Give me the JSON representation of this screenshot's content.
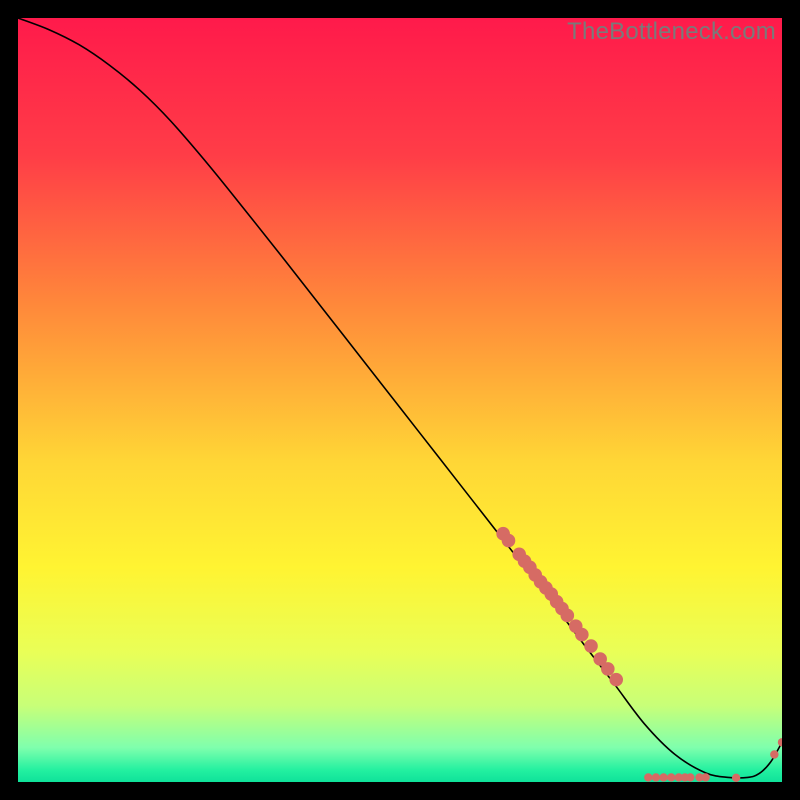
{
  "watermark": {
    "text": "TheBottleneck.com"
  },
  "chart_data": {
    "type": "line",
    "title": "",
    "xlabel": "",
    "ylabel": "",
    "xlim": [
      0,
      100
    ],
    "ylim": [
      0,
      100
    ],
    "grid": false,
    "legend": false,
    "background_gradient": {
      "stops": [
        {
          "pos": 0.0,
          "color": "#ff1a4b"
        },
        {
          "pos": 0.18,
          "color": "#ff3d47"
        },
        {
          "pos": 0.38,
          "color": "#ff8a3a"
        },
        {
          "pos": 0.58,
          "color": "#ffd636"
        },
        {
          "pos": 0.72,
          "color": "#fff432"
        },
        {
          "pos": 0.83,
          "color": "#e9ff57"
        },
        {
          "pos": 0.9,
          "color": "#c8ff78"
        },
        {
          "pos": 0.955,
          "color": "#7fffad"
        },
        {
          "pos": 0.985,
          "color": "#22f0a0"
        },
        {
          "pos": 1.0,
          "color": "#0fe29a"
        }
      ]
    },
    "series": [
      {
        "name": "bottleneck-curve",
        "color": "#000000",
        "width": 1.6,
        "x": [
          0,
          4,
          8,
          12,
          16,
          20,
          25,
          30,
          35,
          40,
          45,
          50,
          55,
          60,
          65,
          70,
          74,
          78,
          82,
          86,
          90,
          93,
          95.5,
          97,
          98.5,
          100
        ],
        "y": [
          100,
          98.5,
          96.5,
          93.8,
          90.5,
          86.5,
          80.7,
          74.5,
          68.2,
          61.8,
          55.4,
          49.0,
          42.6,
          36.2,
          29.8,
          23.4,
          18.1,
          12.9,
          7.6,
          3.6,
          1.2,
          0.6,
          0.6,
          1.1,
          2.6,
          5.2
        ]
      }
    ],
    "markers": {
      "color": "#d66b64",
      "radius_small": 4.2,
      "radius_large": 6.8,
      "cluster1": {
        "x": [
          63.5,
          64.2,
          65.6,
          66.3,
          67.0,
          67.7,
          68.4,
          69.1,
          69.8,
          70.5,
          71.2,
          71.9,
          73.0,
          73.8
        ],
        "y": [
          32.5,
          31.6,
          29.8,
          28.9,
          28.1,
          27.1,
          26.2,
          25.4,
          24.6,
          23.6,
          22.7,
          21.8,
          20.4,
          19.3
        ]
      },
      "cluster1b": {
        "x": [
          75.0,
          76.2,
          77.2,
          78.3
        ],
        "y": [
          17.8,
          16.1,
          14.8,
          13.4
        ]
      },
      "cluster2_row": {
        "x": [
          82.5,
          83.5,
          84.5,
          85.5,
          86.5,
          87.3,
          88.0,
          89.2,
          90.0,
          94.0
        ],
        "y": [
          0.6,
          0.6,
          0.6,
          0.6,
          0.6,
          0.6,
          0.6,
          0.6,
          0.6,
          0.55
        ]
      },
      "cluster3_end": {
        "x": [
          99.0,
          100.0
        ],
        "y": [
          3.6,
          5.2
        ]
      }
    }
  }
}
